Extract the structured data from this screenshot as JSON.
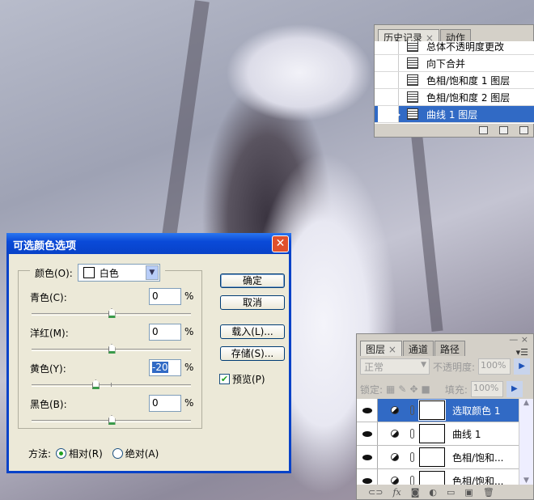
{
  "history_panel": {
    "tabs": [
      "历史记录",
      "动作"
    ],
    "tab_close": "×",
    "items": [
      "总体不透明度更改",
      "向下合并",
      "色相/饱和度 1 图层",
      "色相/饱和度 2 图层",
      "曲线 1 图层"
    ],
    "selected_index": 4
  },
  "dialog": {
    "title": "可选颜色选项",
    "close": "✕",
    "color_label": "颜色(O):",
    "color_value": "白色",
    "fields": [
      {
        "label": "青色(C):",
        "value": "0",
        "unit": "%"
      },
      {
        "label": "洋红(M):",
        "value": "0",
        "unit": "%"
      },
      {
        "label": "黄色(Y):",
        "value": "-20",
        "unit": "%"
      },
      {
        "label": "黑色(B):",
        "value": "0",
        "unit": "%"
      }
    ],
    "slider_range": [
      -100,
      100
    ],
    "buttons": {
      "ok": "确定",
      "cancel": "取消",
      "load": "载入(L)...",
      "save": "存储(S)..."
    },
    "preview_label": "预览(P)",
    "preview_checked": true,
    "method_label": "方法:",
    "method_options": [
      "相对(R)",
      "绝对(A)"
    ],
    "method_selected": 0
  },
  "layers_panel": {
    "tabs": [
      "图层",
      "通道",
      "路径"
    ],
    "tab_close": "×",
    "blend_mode": "正常",
    "opacity_label": "不透明度:",
    "opacity": "100%",
    "lock_label": "锁定:",
    "fill_label": "填充:",
    "fill": "100%",
    "layers": [
      "选取颜色 1",
      "曲线 1",
      "色相/饱和...",
      "色相/饱和..."
    ],
    "selected_index": 0,
    "footer_fx": "fx"
  },
  "colors": {
    "selection": "#316ac5",
    "titlebar": "#0842c8"
  }
}
